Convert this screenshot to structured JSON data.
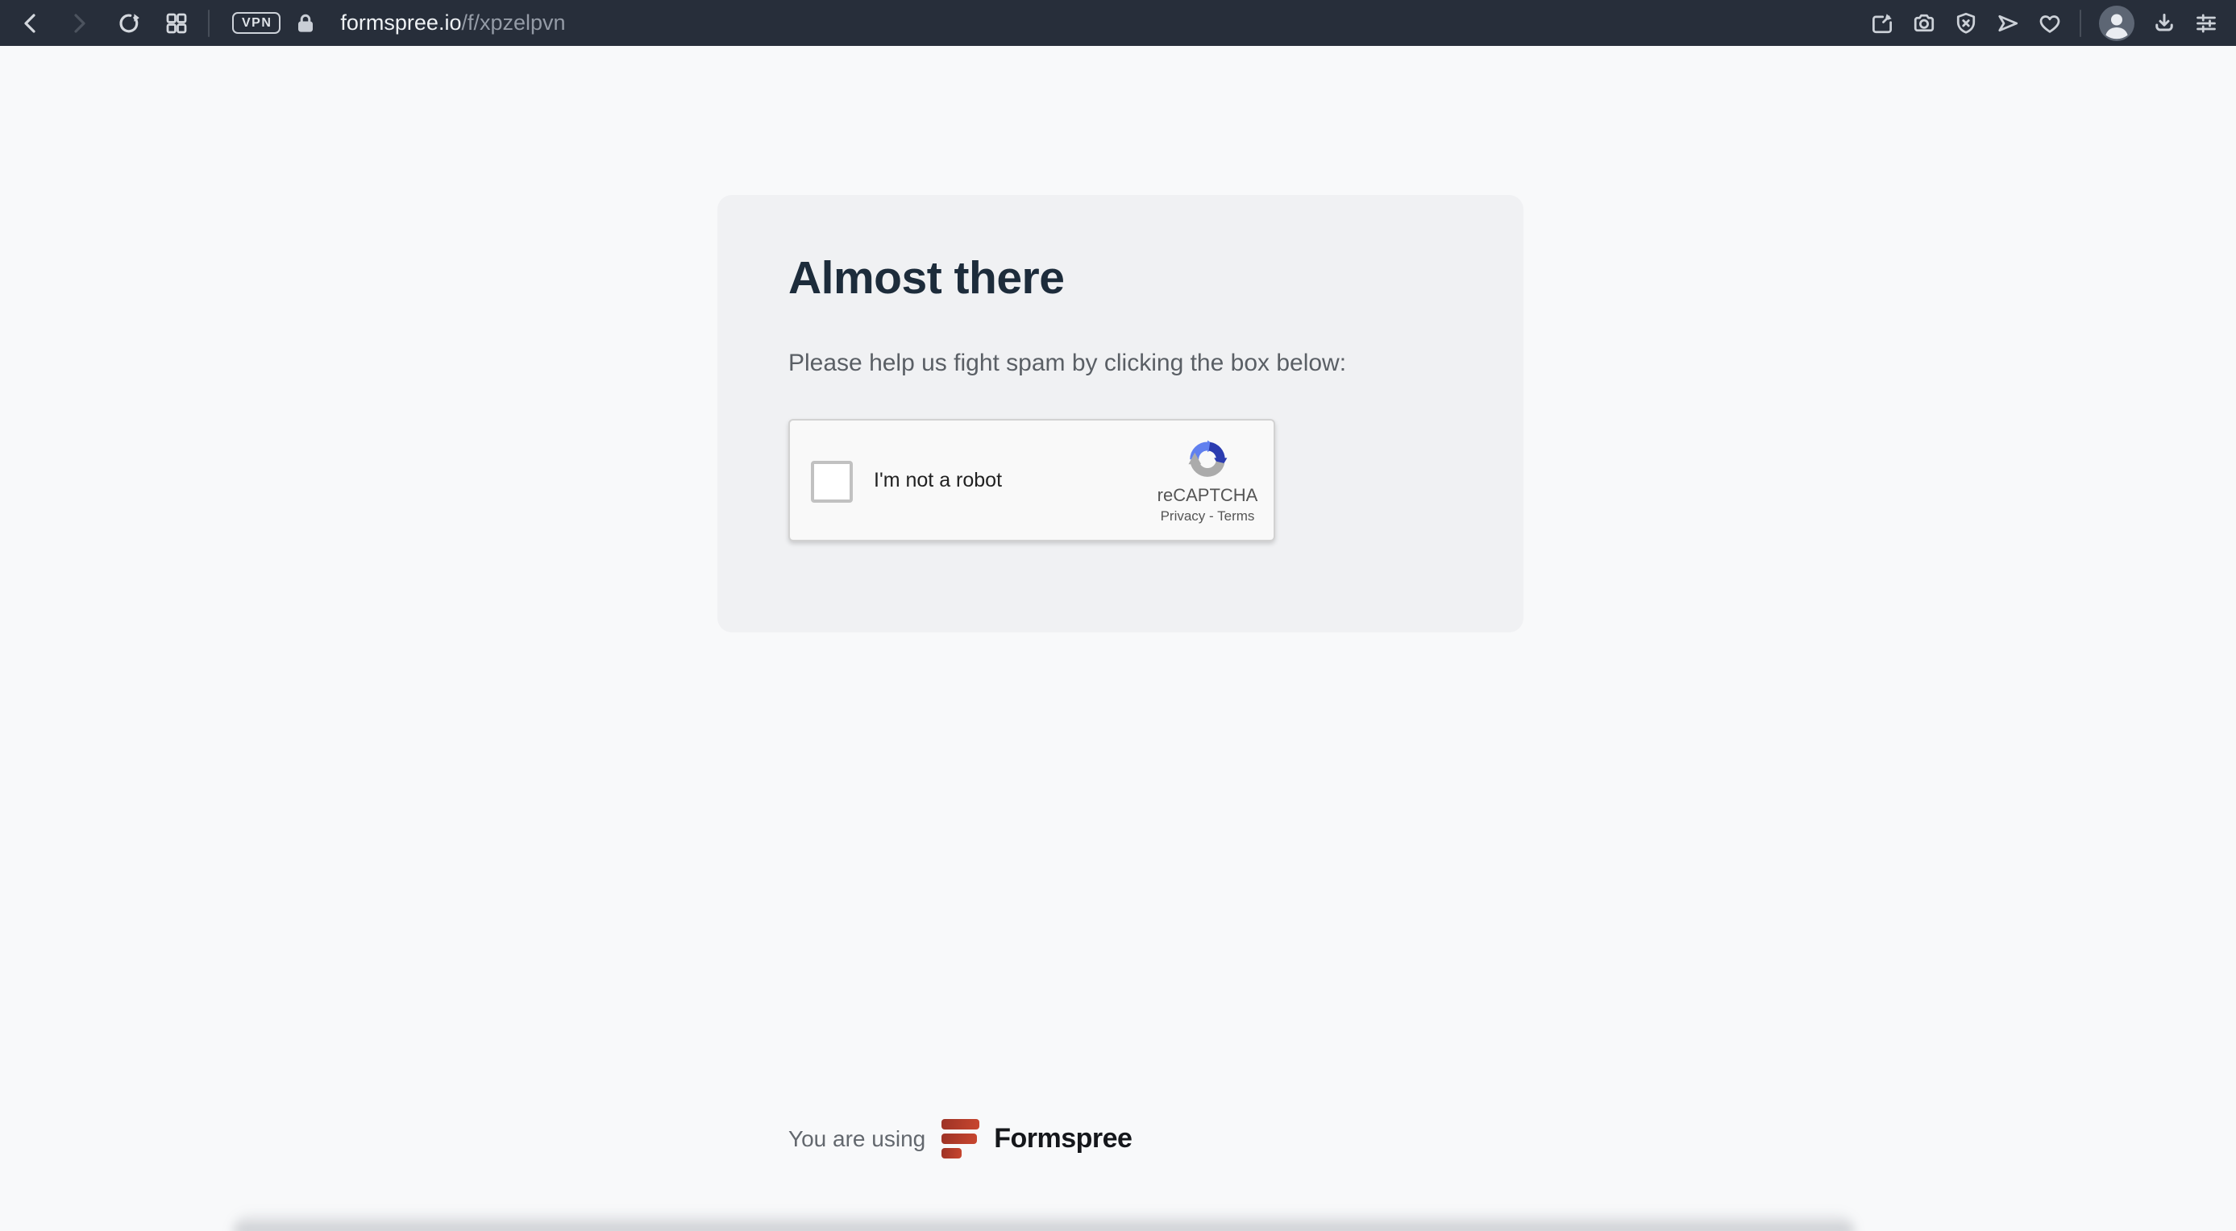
{
  "browser": {
    "vpn_label": "VPN",
    "url_domain": "formspree.io",
    "url_path": "/f/xpzelpvn",
    "toolbar_icons_left": [
      "back",
      "forward",
      "reload",
      "tab-grid"
    ],
    "toolbar_icons_right": [
      "pin",
      "camera",
      "shield-block",
      "send",
      "heart",
      "profile-avatar",
      "download",
      "settings-sliders"
    ]
  },
  "main": {
    "heading": "Almost there",
    "subtext": "Please help us fight spam by clicking the box below:"
  },
  "recaptcha": {
    "label": "I'm not a robot",
    "brand": "reCAPTCHA",
    "privacy": "Privacy",
    "dash": "-",
    "terms": "Terms"
  },
  "footer": {
    "prefix": "You are using",
    "brand": "Formspree"
  },
  "colors": {
    "topbar_bg": "#272e3a",
    "page_bg": "#f8f9fa",
    "card_bg": "#f0f1f3",
    "heading_text": "#1d2c3b",
    "formspree_red": "#c8462f",
    "recaptcha_blue_light": "#6180ef",
    "recaptcha_blue_dark": "#2b3cb0",
    "recaptcha_gray": "#ababab"
  }
}
